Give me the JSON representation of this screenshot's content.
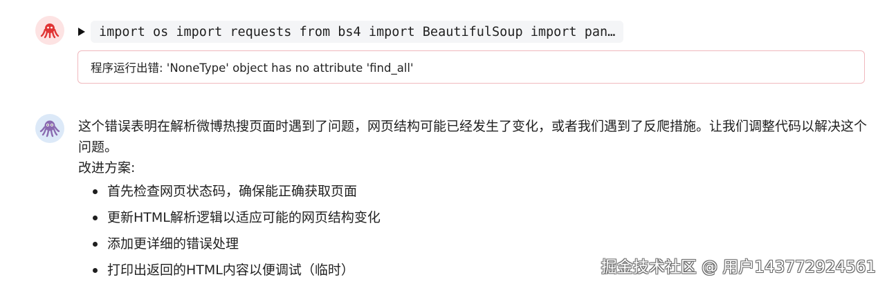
{
  "user_message": {
    "avatar_icon": "octopus-icon",
    "avatar_color": "#fde3e3",
    "toggle_icon": "caret-right-icon",
    "code_preview": "import os import requests from bs4 import BeautifulSoup import pan…",
    "error_text": "程序运行出错: 'NoneType' object has no attribute 'find_all'",
    "error_border_color": "#f0b8bd"
  },
  "assistant_message": {
    "avatar_icon": "octopus-bot-icon",
    "avatar_color": "#dce9f8",
    "paragraph": "这个错误表明在解析微博热搜页面时遇到了问题，网页结构可能已经发生了变化，或者我们遇到了反爬措施。让我们调整代码以解决这个问题。",
    "subheading": "改进方案:",
    "bullets": [
      "首先检查网页状态码，确保能正确获取页面",
      "更新HTML解析逻辑以适应可能的网页结构变化",
      "添加更详细的错误处理",
      "打印出返回的HTML内容以便调试（临时）"
    ]
  },
  "watermark": "掘金技术社区 @ 用户14377292456​1"
}
